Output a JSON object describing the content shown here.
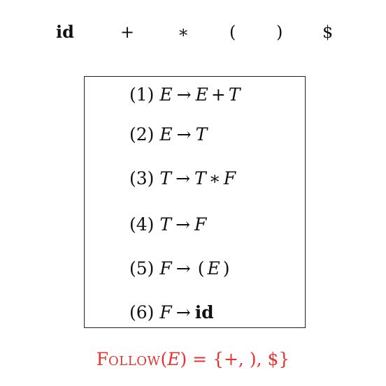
{
  "terminals": [
    "id",
    "+",
    "∗",
    "(",
    ")",
    "$"
  ],
  "productions": [
    {
      "number": "(1)",
      "lhs": "E",
      "arrow": "→",
      "rhs": [
        {
          "t": "nt",
          "v": "E"
        },
        {
          "t": "op",
          "v": "+"
        },
        {
          "t": "nt",
          "v": "T"
        }
      ]
    },
    {
      "number": "(2)",
      "lhs": "E",
      "arrow": "→",
      "rhs": [
        {
          "t": "nt",
          "v": "T"
        }
      ]
    },
    {
      "number": "(3)",
      "lhs": "T",
      "arrow": "→",
      "rhs": [
        {
          "t": "nt",
          "v": "T"
        },
        {
          "t": "op",
          "v": "∗"
        },
        {
          "t": "nt",
          "v": "F"
        }
      ]
    },
    {
      "number": "(4)",
      "lhs": "T",
      "arrow": "→",
      "rhs": [
        {
          "t": "nt",
          "v": "F"
        }
      ]
    },
    {
      "number": "(5)",
      "lhs": "F",
      "arrow": "→",
      "rhs": [
        {
          "t": "op",
          "v": "("
        },
        {
          "t": "nt",
          "v": "E"
        },
        {
          "t": "op",
          "v": ")"
        }
      ]
    },
    {
      "number": "(6)",
      "lhs": "F",
      "arrow": "→",
      "rhs": [
        {
          "t": "kw",
          "v": "id"
        }
      ]
    }
  ],
  "follow": {
    "function_initial": "F",
    "function_rest": "OLLOW",
    "open_paren": "(",
    "argument": "E",
    "rest": ") = {+, ), $}"
  },
  "colors": {
    "text": "#111111",
    "box_border": "#222222",
    "follow": "#e8322f"
  }
}
